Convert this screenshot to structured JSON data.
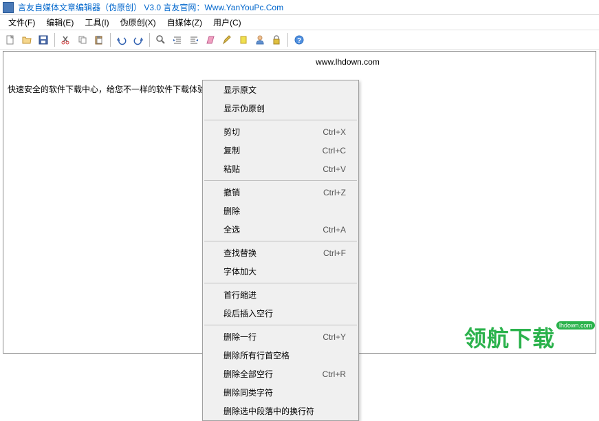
{
  "title": "言友自媒体文章编辑器（伪原创） V3.0 言友官网：Www.YanYouPc.Com",
  "menubar": [
    {
      "label": "文件(F)",
      "name": "menu-file"
    },
    {
      "label": "编辑(E)",
      "name": "menu-edit"
    },
    {
      "label": "工具(I)",
      "name": "menu-tools"
    },
    {
      "label": "伪原创(X)",
      "name": "menu-pseudo"
    },
    {
      "label": "自媒体(Z)",
      "name": "menu-media"
    },
    {
      "label": "用户(C)",
      "name": "menu-user"
    }
  ],
  "editor": {
    "url": "www.lhdown.com",
    "text": "快速安全的软件下载中心，给您不一样的软件下载体验！"
  },
  "context_menu": [
    {
      "label": "显示原文",
      "shortcut": ""
    },
    {
      "label": "显示伪原创",
      "shortcut": ""
    },
    {
      "type": "sep"
    },
    {
      "label": "剪切",
      "shortcut": "Ctrl+X"
    },
    {
      "label": "复制",
      "shortcut": "Ctrl+C"
    },
    {
      "label": "粘贴",
      "shortcut": "Ctrl+V"
    },
    {
      "type": "sep"
    },
    {
      "label": "撤销",
      "shortcut": "Ctrl+Z"
    },
    {
      "label": "删除",
      "shortcut": ""
    },
    {
      "label": "全选",
      "shortcut": "Ctrl+A"
    },
    {
      "type": "sep"
    },
    {
      "label": "查找替换",
      "shortcut": "Ctrl+F"
    },
    {
      "label": "字体加大",
      "shortcut": ""
    },
    {
      "type": "sep"
    },
    {
      "label": "首行缩进",
      "shortcut": ""
    },
    {
      "label": "段后插入空行",
      "shortcut": ""
    },
    {
      "type": "sep"
    },
    {
      "label": "删除一行",
      "shortcut": "Ctrl+Y"
    },
    {
      "label": "删除所有行首空格",
      "shortcut": ""
    },
    {
      "label": "删除全部空行",
      "shortcut": "Ctrl+R"
    },
    {
      "label": "删除同类字符",
      "shortcut": ""
    },
    {
      "label": "删除选中段落中的换行符",
      "shortcut": ""
    }
  ],
  "watermark": {
    "text": "领航下载",
    "badge": "lhdown.com"
  }
}
